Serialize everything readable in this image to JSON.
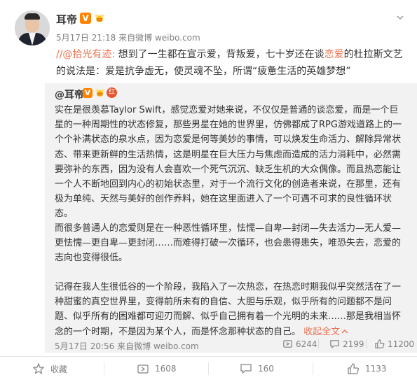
{
  "post": {
    "author": "耳帝",
    "verified_badge": "V",
    "time": "5月17日 21:18",
    "source_prefix": "来自",
    "source": "微博 weibo.com",
    "mention": "//@拾光有迹:",
    "text_before": " 想到了一生都在宣示爱，背叛爱，七十岁还在谈",
    "highlight": "恋爱",
    "text_after": "的杜拉斯文艺的说法是：爱是抗争虚无，使灵魂不坠，所谓“疲惫生活的英雄梦想”"
  },
  "repost": {
    "author": "@耳帝",
    "verified_badge": "V",
    "red_badge": "红",
    "paragraph1": "实在是很羡慕Taylor Swift，感觉恋爱对她来说，不仅仅是普通的谈恋爱，而是一个巨星的一种周期性的状态修复，那些男星在她的世界里，仿佛都成了RPG游戏道路上的一个个补满状态的泉水点，因为恋爱是何等美妙的事情，可以焕发生命活力、解除异常状态、带来更新鲜的生活热情，这是明星在巨大压力与焦虑而造成的活力消耗中，必然需要弥补的东西，因为没有人会喜欢一个死气沉沉、缺乏生机的大众偶像。而且热恋能让一个人不断地回到内心的初始状态里，对于一个流行文化的创造者来说，在那里，还有极为单纯、天然与美好的创作养料，她在这里面进入了一个可遇不可求的良性循环状态。",
    "paragraph2": "而很多普通人的恋爱则是在一种恶性循环里，怯懦—自卑—封闭—失去活力—无人爱—更怯懦—更自卑—更封闭……而难得打破一次循环，也会患得患失，唯恐失去，恋爱的志向也变得很低。",
    "paragraph3": "记得在我人生很低谷的一个阶段，我陷入了一次热恋，在热恋时期我似乎突然活在了一种甜蜜的真空世界里，变得前所未有的自信、大胆与乐观，似乎所有的问题都不是问题、似乎所有的困难都可迎刃而解、似乎自己拥有着一个光明的未来……那是我相当怀念的一个时期，不是因为某个人，而是怀念那种状态的自己。",
    "expand_label": "收起全文",
    "expand_icon": "chevron-up",
    "time": "5月17日 20:56",
    "source_prefix": "来自",
    "source": "微博 weibo.com",
    "reposts": "6244",
    "comments": "2199",
    "likes": "11200"
  },
  "actions": {
    "favorite": "收藏",
    "repost": "1608",
    "comment": "160",
    "like": "1133"
  },
  "colors": {
    "link": "#eb7350",
    "badge": "#ff8200",
    "repost_bg": "#f2f2f2",
    "meta": "#808080"
  }
}
